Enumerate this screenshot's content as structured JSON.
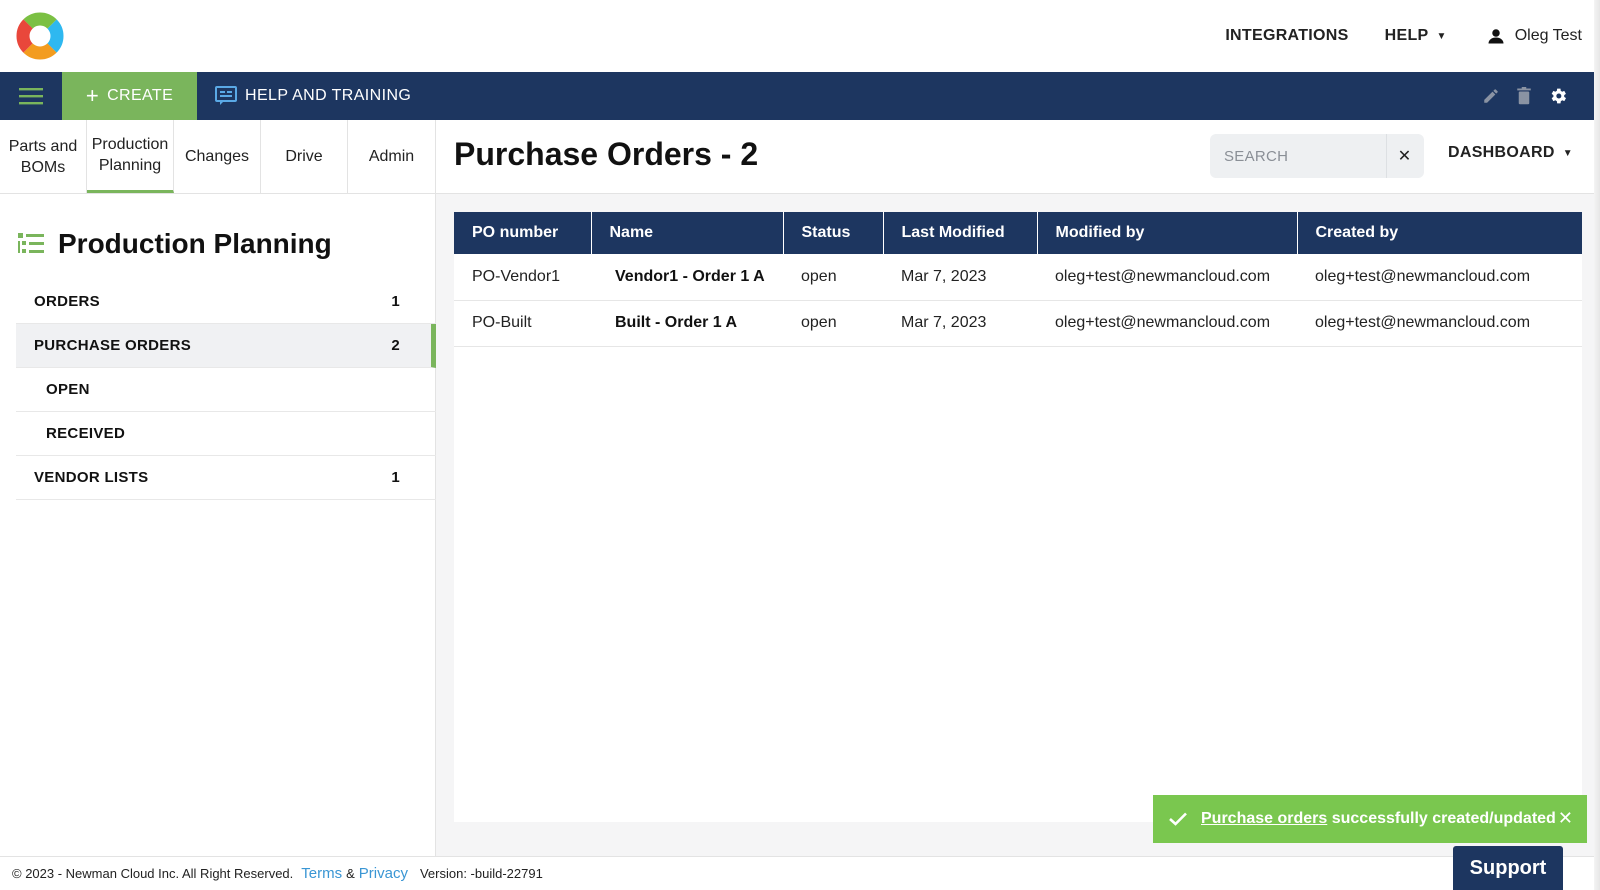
{
  "header": {
    "integrations_label": "INTEGRATIONS",
    "help_label": "HELP",
    "user_name": "Oleg Test"
  },
  "navbar": {
    "create_label": "CREATE",
    "help_training_label": "HELP AND TRAINING"
  },
  "tabs": [
    {
      "line1": "Parts and",
      "line2": "BOMs"
    },
    {
      "line1": "Production",
      "line2": "Planning"
    },
    {
      "line1": "Changes",
      "line2": ""
    },
    {
      "line1": "Drive",
      "line2": ""
    },
    {
      "line1": "Admin",
      "line2": ""
    }
  ],
  "sidebar": {
    "title": "Production Planning",
    "items": [
      {
        "label": "ORDERS",
        "count": "1"
      },
      {
        "label": "PURCHASE ORDERS",
        "count": "2"
      },
      {
        "label": "OPEN",
        "count": ""
      },
      {
        "label": "RECEIVED",
        "count": ""
      },
      {
        "label": "VENDOR LISTS",
        "count": "1"
      }
    ]
  },
  "main": {
    "title": "Purchase Orders - 2",
    "search_placeholder": "SEARCH",
    "dashboard_label": "DASHBOARD"
  },
  "table": {
    "headers": [
      "PO number",
      "Name",
      "Status",
      "Last Modified",
      "Modified by",
      "Created by"
    ],
    "rows": [
      [
        "PO-Vendor1",
        "Vendor1 - Order 1 A",
        "open",
        "Mar 7, 2023",
        "oleg+test@newmancloud.com",
        "oleg+test@newmancloud.com"
      ],
      [
        "PO-Built",
        "Built - Order 1 A",
        "open",
        "Mar 7, 2023",
        "oleg+test@newmancloud.com",
        "oleg+test@newmancloud.com"
      ]
    ]
  },
  "toast": {
    "link_text": "Purchase orders",
    "message": " successfully created/updated"
  },
  "footer": {
    "copyright": "© 2023 - Newman Cloud Inc. All Right Reserved.",
    "terms": "Terms",
    "amp": "&",
    "privacy": "Privacy",
    "version": "Version: -build-22791"
  },
  "support_label": "Support",
  "colors": {
    "navy": "#1d3660",
    "green": "#7ab55c",
    "toast_green": "#7ac74f",
    "link_blue": "#3a96d4"
  }
}
